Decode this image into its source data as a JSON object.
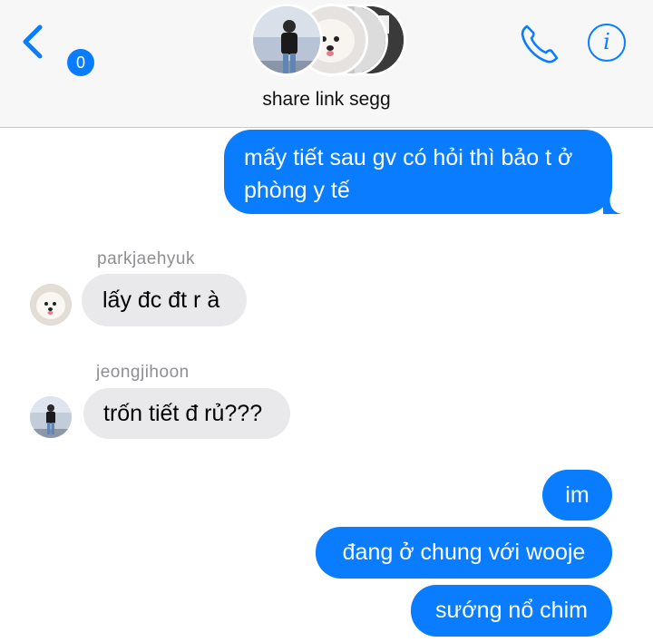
{
  "header": {
    "unread_count": "0",
    "group_name": "share link segg",
    "icons": {
      "back": "chevron-left-icon",
      "call": "phone-icon",
      "info": "info-icon"
    },
    "info_glyph": "i",
    "accent_color": "#0a7cff"
  },
  "messages": [
    {
      "direction": "sent",
      "text": "mấy tiết sau gv có hỏi thì bảo t ở phòng y tế"
    },
    {
      "direction": "received",
      "sender": "parkjaehyuk",
      "text": "lấy đc đt r à"
    },
    {
      "direction": "received",
      "sender": "jeongjihoon",
      "text": "trốn tiết đ rủ???"
    },
    {
      "direction": "sent",
      "text": "im"
    },
    {
      "direction": "sent",
      "text": "đang ở chung với wooje"
    },
    {
      "direction": "sent",
      "text": "sướng nổ chim"
    }
  ],
  "colors": {
    "sent_bubble": "#0a7cff",
    "received_bubble": "#e9e9eb",
    "sender_label": "#8e8e93",
    "header_bg": "#f7f7f7"
  }
}
